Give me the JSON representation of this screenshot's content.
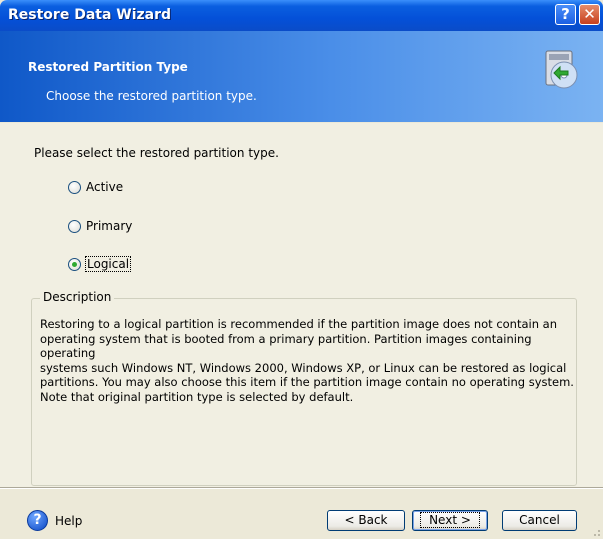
{
  "window": {
    "title": "Restore Data Wizard",
    "help_button": "?",
    "close_button": "✕"
  },
  "header": {
    "title": "Restored Partition Type",
    "subtitle": "Choose the restored partition type."
  },
  "content": {
    "prompt": "Please select the restored partition type.",
    "options": [
      {
        "label": "Active",
        "checked": false
      },
      {
        "label": "Primary",
        "checked": false
      },
      {
        "label": "Logical",
        "checked": true
      }
    ],
    "description": {
      "title": "Description",
      "lines": [
        "Restoring to a logical partition is recommended if the partition image does not contain an",
        "operating system that is booted from a primary partition. Partition images containing operating",
        "systems such Windows NT, Windows 2000, Windows XP, or Linux can be restored as logical",
        "partitions. You may also choose this item if the partition image contain no operating system.",
        "Note that original partition type is selected by default."
      ]
    }
  },
  "footer": {
    "help_icon": "?",
    "help_label": "Help",
    "back_label": "< Back",
    "next_label": "Next >",
    "cancel_label": "Cancel"
  },
  "colors": {
    "title_bar": "#0450d8",
    "header_gradient_start": "#0f58c8",
    "header_gradient_end": "#7bb3f2",
    "content_bg": "#f1efe2",
    "radio_checked": "#2fa932"
  }
}
